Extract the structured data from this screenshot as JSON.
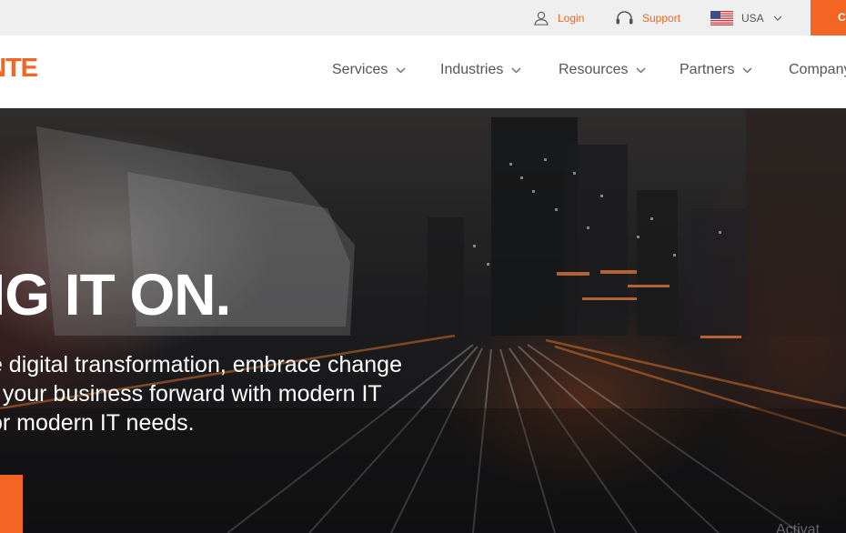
{
  "topbar": {
    "login_label": "Login",
    "support_label": "Support",
    "region_label": "USA",
    "contact_label": "C"
  },
  "brand": {
    "logo_text": "NTE",
    "accent_color": "#f26522"
  },
  "nav": {
    "items": [
      {
        "label": "Services"
      },
      {
        "label": "Industries"
      },
      {
        "label": "Resources"
      },
      {
        "label": "Partners"
      },
      {
        "label": "Company"
      }
    ]
  },
  "hero": {
    "title": "NG IT ON.",
    "subtitle_lines": [
      "te digital transformation, embrace change",
      "e your business forward with modern IT",
      "for modern IT needs."
    ],
    "watermark_text": "Activat"
  },
  "icons": {
    "login": "user-icon",
    "support": "headset-icon",
    "region": "us-flag-icon",
    "dropdown": "chevron-down-icon"
  }
}
